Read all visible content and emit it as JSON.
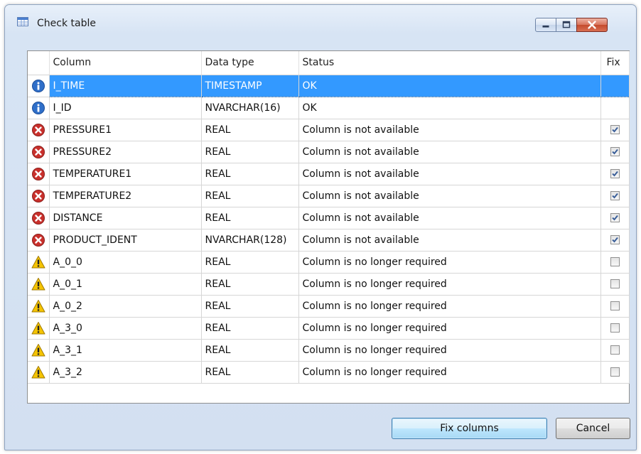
{
  "window": {
    "title": "Check table",
    "title_icon": "table-icon",
    "controls": [
      "minimize-icon",
      "maximize-icon",
      "close-icon"
    ]
  },
  "table": {
    "headers": {
      "column": "Column",
      "data_type": "Data type",
      "status": "Status",
      "fix": "Fix"
    },
    "rows": [
      {
        "icon": "info-icon",
        "column": "I_TIME",
        "data_type": "TIMESTAMP",
        "status": "OK",
        "fix": null,
        "selected": true
      },
      {
        "icon": "info-icon",
        "column": "I_ID",
        "data_type": "NVARCHAR(16)",
        "status": "OK",
        "fix": null,
        "selected": false
      },
      {
        "icon": "error-icon",
        "column": "PRESSURE1",
        "data_type": "REAL",
        "status": "Column is not available",
        "fix": true,
        "selected": false
      },
      {
        "icon": "error-icon",
        "column": "PRESSURE2",
        "data_type": "REAL",
        "status": "Column is not available",
        "fix": true,
        "selected": false
      },
      {
        "icon": "error-icon",
        "column": "TEMPERATURE1",
        "data_type": "REAL",
        "status": "Column is not available",
        "fix": true,
        "selected": false
      },
      {
        "icon": "error-icon",
        "column": "TEMPERATURE2",
        "data_type": "REAL",
        "status": "Column is not available",
        "fix": true,
        "selected": false
      },
      {
        "icon": "error-icon",
        "column": "DISTANCE",
        "data_type": "REAL",
        "status": "Column is not available",
        "fix": true,
        "selected": false
      },
      {
        "icon": "error-icon",
        "column": "PRODUCT_IDENT",
        "data_type": "NVARCHAR(128)",
        "status": "Column is not available",
        "fix": true,
        "selected": false
      },
      {
        "icon": "warning-icon",
        "column": "A_0_0",
        "data_type": "REAL",
        "status": "Column is no longer required",
        "fix": false,
        "selected": false
      },
      {
        "icon": "warning-icon",
        "column": "A_0_1",
        "data_type": "REAL",
        "status": "Column is no longer required",
        "fix": false,
        "selected": false
      },
      {
        "icon": "warning-icon",
        "column": "A_0_2",
        "data_type": "REAL",
        "status": "Column is no longer required",
        "fix": false,
        "selected": false
      },
      {
        "icon": "warning-icon",
        "column": "A_3_0",
        "data_type": "REAL",
        "status": "Column is no longer required",
        "fix": false,
        "selected": false
      },
      {
        "icon": "warning-icon",
        "column": "A_3_1",
        "data_type": "REAL",
        "status": "Column is no longer required",
        "fix": false,
        "selected": false
      },
      {
        "icon": "warning-icon",
        "column": "A_3_2",
        "data_type": "REAL",
        "status": "Column is no longer required",
        "fix": false,
        "selected": false
      }
    ]
  },
  "buttons": {
    "fix_columns": "Fix columns",
    "cancel": "Cancel"
  },
  "colors": {
    "selection": "#3399ff",
    "info": "#2f6fc9",
    "error": "#c9302c",
    "warning": "#f5c400"
  }
}
